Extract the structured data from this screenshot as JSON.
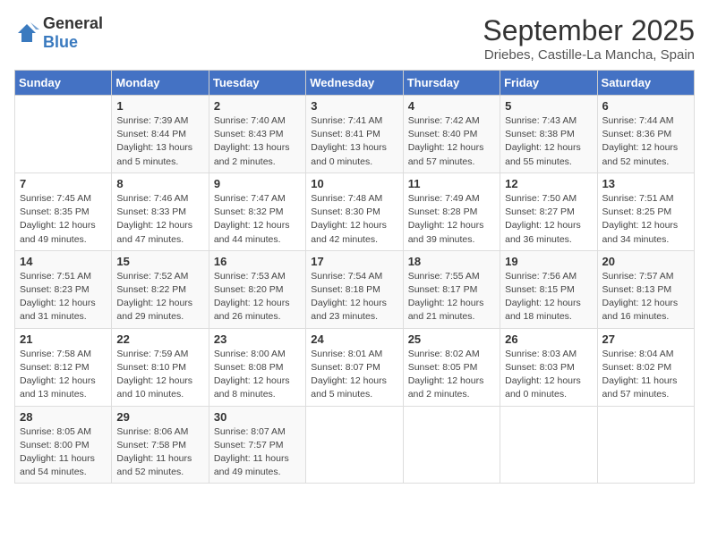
{
  "logo": {
    "general": "General",
    "blue": "Blue"
  },
  "title": "September 2025",
  "subtitle": "Driebes, Castille-La Mancha, Spain",
  "headers": [
    "Sunday",
    "Monday",
    "Tuesday",
    "Wednesday",
    "Thursday",
    "Friday",
    "Saturday"
  ],
  "weeks": [
    [
      {
        "day": "",
        "info": ""
      },
      {
        "day": "1",
        "info": "Sunrise: 7:39 AM\nSunset: 8:44 PM\nDaylight: 13 hours\nand 5 minutes."
      },
      {
        "day": "2",
        "info": "Sunrise: 7:40 AM\nSunset: 8:43 PM\nDaylight: 13 hours\nand 2 minutes."
      },
      {
        "day": "3",
        "info": "Sunrise: 7:41 AM\nSunset: 8:41 PM\nDaylight: 13 hours\nand 0 minutes."
      },
      {
        "day": "4",
        "info": "Sunrise: 7:42 AM\nSunset: 8:40 PM\nDaylight: 12 hours\nand 57 minutes."
      },
      {
        "day": "5",
        "info": "Sunrise: 7:43 AM\nSunset: 8:38 PM\nDaylight: 12 hours\nand 55 minutes."
      },
      {
        "day": "6",
        "info": "Sunrise: 7:44 AM\nSunset: 8:36 PM\nDaylight: 12 hours\nand 52 minutes."
      }
    ],
    [
      {
        "day": "7",
        "info": "Sunrise: 7:45 AM\nSunset: 8:35 PM\nDaylight: 12 hours\nand 49 minutes."
      },
      {
        "day": "8",
        "info": "Sunrise: 7:46 AM\nSunset: 8:33 PM\nDaylight: 12 hours\nand 47 minutes."
      },
      {
        "day": "9",
        "info": "Sunrise: 7:47 AM\nSunset: 8:32 PM\nDaylight: 12 hours\nand 44 minutes."
      },
      {
        "day": "10",
        "info": "Sunrise: 7:48 AM\nSunset: 8:30 PM\nDaylight: 12 hours\nand 42 minutes."
      },
      {
        "day": "11",
        "info": "Sunrise: 7:49 AM\nSunset: 8:28 PM\nDaylight: 12 hours\nand 39 minutes."
      },
      {
        "day": "12",
        "info": "Sunrise: 7:50 AM\nSunset: 8:27 PM\nDaylight: 12 hours\nand 36 minutes."
      },
      {
        "day": "13",
        "info": "Sunrise: 7:51 AM\nSunset: 8:25 PM\nDaylight: 12 hours\nand 34 minutes."
      }
    ],
    [
      {
        "day": "14",
        "info": "Sunrise: 7:51 AM\nSunset: 8:23 PM\nDaylight: 12 hours\nand 31 minutes."
      },
      {
        "day": "15",
        "info": "Sunrise: 7:52 AM\nSunset: 8:22 PM\nDaylight: 12 hours\nand 29 minutes."
      },
      {
        "day": "16",
        "info": "Sunrise: 7:53 AM\nSunset: 8:20 PM\nDaylight: 12 hours\nand 26 minutes."
      },
      {
        "day": "17",
        "info": "Sunrise: 7:54 AM\nSunset: 8:18 PM\nDaylight: 12 hours\nand 23 minutes."
      },
      {
        "day": "18",
        "info": "Sunrise: 7:55 AM\nSunset: 8:17 PM\nDaylight: 12 hours\nand 21 minutes."
      },
      {
        "day": "19",
        "info": "Sunrise: 7:56 AM\nSunset: 8:15 PM\nDaylight: 12 hours\nand 18 minutes."
      },
      {
        "day": "20",
        "info": "Sunrise: 7:57 AM\nSunset: 8:13 PM\nDaylight: 12 hours\nand 16 minutes."
      }
    ],
    [
      {
        "day": "21",
        "info": "Sunrise: 7:58 AM\nSunset: 8:12 PM\nDaylight: 12 hours\nand 13 minutes."
      },
      {
        "day": "22",
        "info": "Sunrise: 7:59 AM\nSunset: 8:10 PM\nDaylight: 12 hours\nand 10 minutes."
      },
      {
        "day": "23",
        "info": "Sunrise: 8:00 AM\nSunset: 8:08 PM\nDaylight: 12 hours\nand 8 minutes."
      },
      {
        "day": "24",
        "info": "Sunrise: 8:01 AM\nSunset: 8:07 PM\nDaylight: 12 hours\nand 5 minutes."
      },
      {
        "day": "25",
        "info": "Sunrise: 8:02 AM\nSunset: 8:05 PM\nDaylight: 12 hours\nand 2 minutes."
      },
      {
        "day": "26",
        "info": "Sunrise: 8:03 AM\nSunset: 8:03 PM\nDaylight: 12 hours\nand 0 minutes."
      },
      {
        "day": "27",
        "info": "Sunrise: 8:04 AM\nSunset: 8:02 PM\nDaylight: 11 hours\nand 57 minutes."
      }
    ],
    [
      {
        "day": "28",
        "info": "Sunrise: 8:05 AM\nSunset: 8:00 PM\nDaylight: 11 hours\nand 54 minutes."
      },
      {
        "day": "29",
        "info": "Sunrise: 8:06 AM\nSunset: 7:58 PM\nDaylight: 11 hours\nand 52 minutes."
      },
      {
        "day": "30",
        "info": "Sunrise: 8:07 AM\nSunset: 7:57 PM\nDaylight: 11 hours\nand 49 minutes."
      },
      {
        "day": "",
        "info": ""
      },
      {
        "day": "",
        "info": ""
      },
      {
        "day": "",
        "info": ""
      },
      {
        "day": "",
        "info": ""
      }
    ]
  ]
}
